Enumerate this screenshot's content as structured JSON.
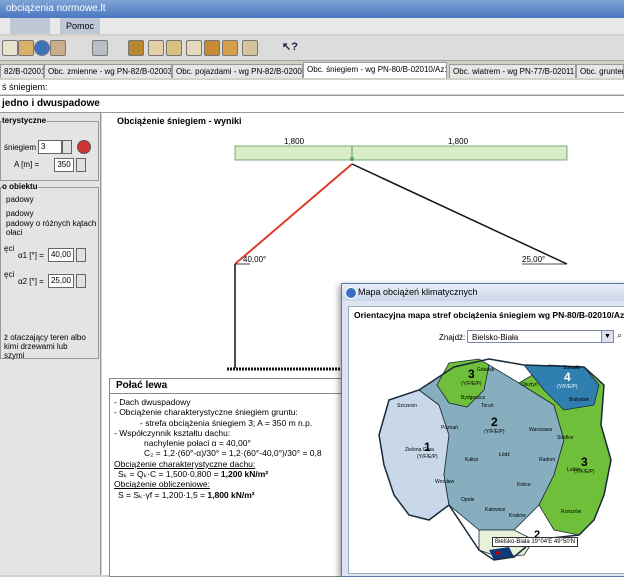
{
  "window": {
    "title": "obciążenia normowe.lt",
    "menu_item": "Pomoc"
  },
  "toolbar": {
    "icons": [
      "new-icon",
      "open-icon",
      "save-icon",
      "help-icon",
      "exit-icon",
      "settings-icon",
      "tool-1-icon",
      "tool-2-icon",
      "tool-3-icon",
      "tool-4-icon",
      "tool-5-icon",
      "tool-6-icon",
      "tool-7-icon",
      "context-help-icon"
    ]
  },
  "tabs": [
    {
      "label": "82/B-02001",
      "active": false
    },
    {
      "label": "Obc. zmienne - wg PN-82/B-02003",
      "active": false
    },
    {
      "label": "Obc. pojazdami - wg PN-82/B-02004",
      "active": false
    },
    {
      "label": "Obc. śniegiem - wg PN-80/B-02010/Az1",
      "active": true
    },
    {
      "label": "Obc. wiatrem - wg PN-77/B-02011",
      "active": false
    },
    {
      "label": "Obc. gruntem",
      "active": false
    }
  ],
  "header": {
    "subtitle": "ś śniegiem:",
    "roof_type": "jedno i dwuspadowe"
  },
  "left_panel": {
    "group1_title": "terystyczne",
    "zone_label": "śniegiem",
    "zone_value": "3",
    "altitude_label": "A [m] =",
    "altitude_value": "350",
    "group2_title": "o obiektu",
    "opt1": "padowy",
    "opt2": "padowy",
    "opt3": "padowy o różnych kątach",
    "opt4": "ołaci",
    "angle1_left": "ęci",
    "angle1_label": "α1 [°] =",
    "angle1_value": "40,00",
    "angle2_left": "ęci",
    "angle2_label": "α2 [°] =",
    "angle2_value": "25,00",
    "note1": "ż otaczający teren albo",
    "note2": "kimi drzewami lub",
    "note3": "szymi"
  },
  "results_title": "Obciążenie śniegiem - wyniki",
  "diagram": {
    "load_left": "1,800",
    "load_right": "1,800",
    "angle_left": "40,00°",
    "angle_right": "25,00°"
  },
  "results_panel": {
    "title": "Połać lewa",
    "l1": "- Dach dwuspadowy",
    "l2": "- Obciążenie charakterystyczne śniegiem gruntu:",
    "l3": "- strefa obciążenia śniegiem 3; A = 350 m n.p.",
    "l4": "- Współczynnik kształtu dachu:",
    "l5": "nachylenie połaci α = 40,00°",
    "l6": "C₂ = 1,2·(60°-α)/30° = 1,2·(60°-40,0°)/30° = 0,8",
    "l7": "Obciążenie charakterystyczne dachu:",
    "l8a": "Sₖ = Qₖ·C = 1,500·0,800 = ",
    "l8b": "1,200 kN/m²",
    "l9": "Obciążenie obliczeniowe:",
    "l10a": "S = Sₖ·γf = 1,200·1,5 = ",
    "l10b": "1,800 kN/m²"
  },
  "map_window": {
    "title": "Mapa obciążeń klimatycznych",
    "heading": "Orientacyjna mapa stref obciążenia śniegiem wg PN-80/B-02010/Az",
    "find_label": "Znajdź:",
    "find_value": "Bielsko-Biała",
    "marker_text": "Bielsko-Biała 19°04'E 49°50'N",
    "zone1": "1",
    "zone1_sub": "(Y/F/E/P)",
    "zone2": "2",
    "zone2_sub": "(Y/F/E/P)",
    "zone3a": "3",
    "zone3a_sub": "(Y/F/E/P)",
    "zone3b": "3",
    "zone3b_sub": "(Y/F/E/P)",
    "zone4": "4",
    "zone4_sub": "(Y/F/E/P)",
    "zone5": "2",
    "cities": [
      "Szczecin",
      "Gdańsk",
      "Olsztyn",
      "Suwałki",
      "Białystok",
      "Bydgoszcz",
      "Toruń",
      "Poznań",
      "Zielona Góra",
      "Warszawa",
      "Łódź",
      "Kalisz",
      "Wrocław",
      "Opole",
      "Kielce",
      "Lublin",
      "Katowice",
      "Kraków",
      "Rzeszów",
      "Radom",
      "Siedlce"
    ],
    "colors": {
      "z1": "#c8d8e8",
      "z2": "#86aebe",
      "z3": "#6fbf3a",
      "z4": "#2f7fb0",
      "border": "#1a2a3a"
    }
  }
}
